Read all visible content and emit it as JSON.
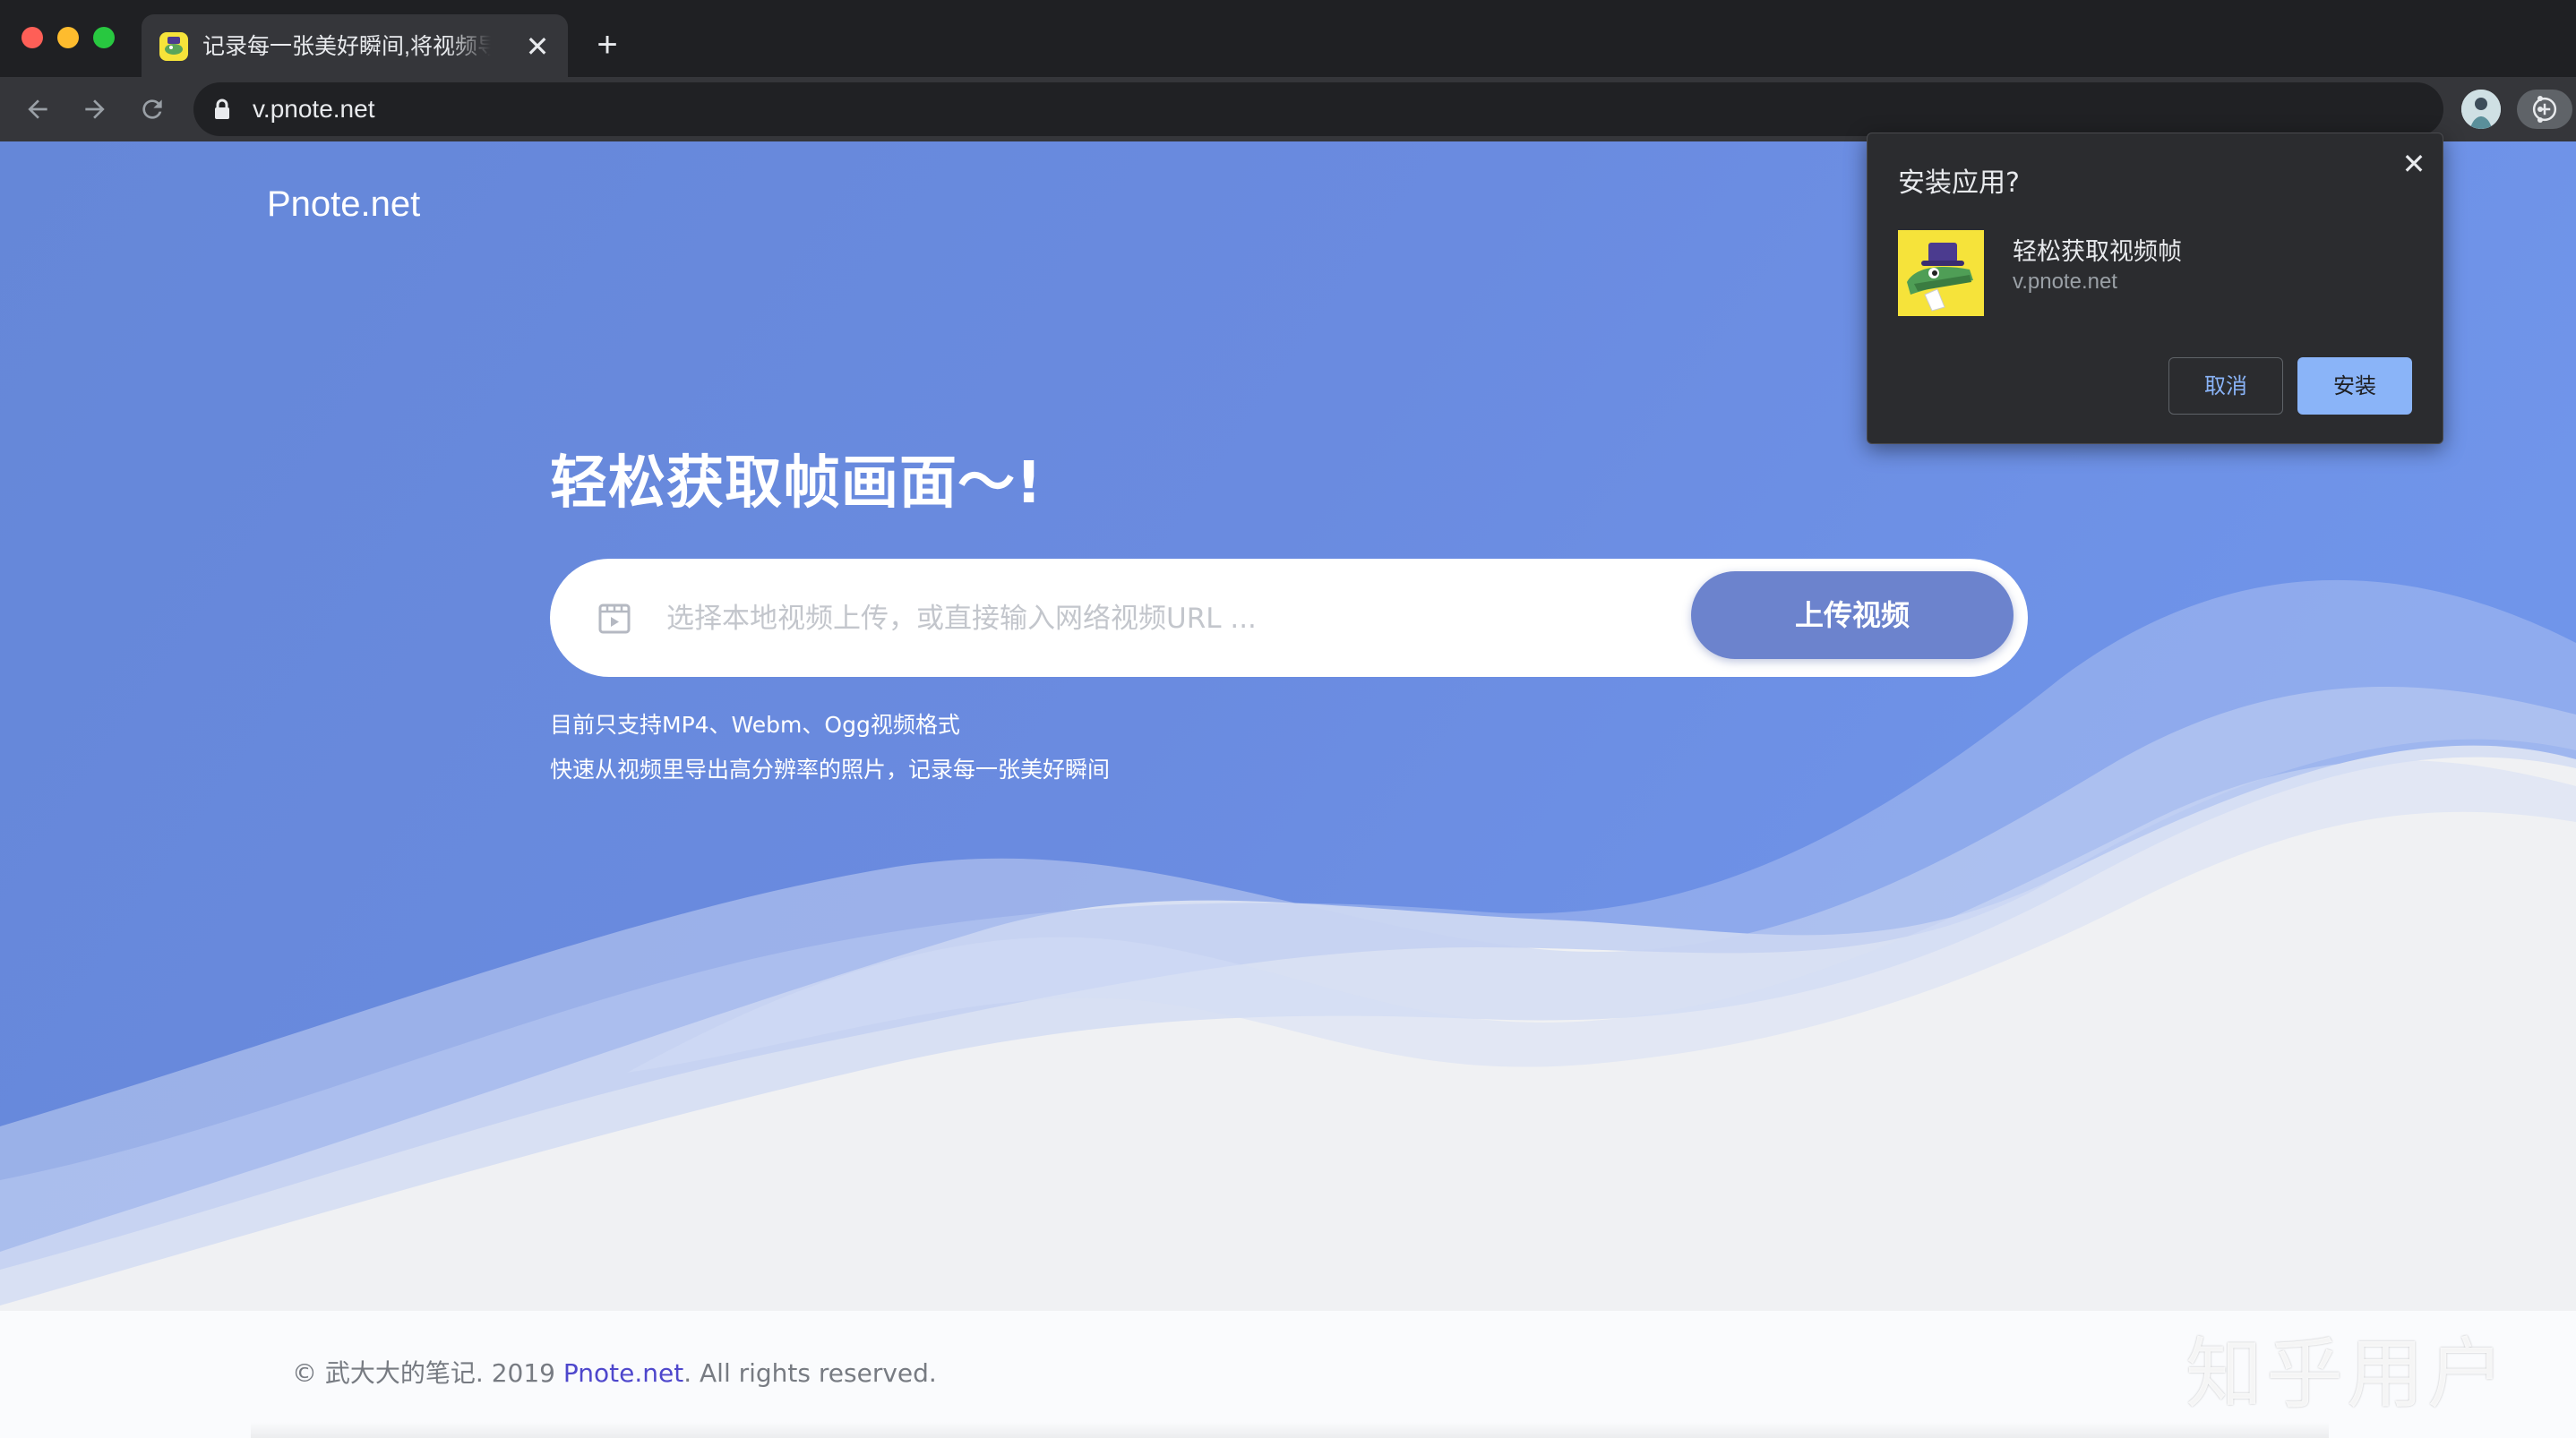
{
  "browser": {
    "tab_title": "记录每一张美好瞬间,将视频导出高分辨率的照片",
    "tab_close": "✕",
    "new_tab": "+",
    "url": "v.pnote.net"
  },
  "page": {
    "brand": "Pnote.net",
    "headline": "轻松获取帧画面～!",
    "search_placeholder": "选择本地视频上传，或直接输入网络视频URL ...",
    "upload_button": "上传视频",
    "note_formats": "目前只支持MP4、Webm、Ogg视频格式",
    "note_desc": "快速从视频里导出高分辨率的照片，记录每一张美好瞬间"
  },
  "footer": {
    "copyright_prefix": "© 武大大的笔记. 2019 ",
    "link_text": "Pnote.net",
    "copyright_suffix": ". All rights reserved.",
    "watermark": "知乎用户"
  },
  "install_dialog": {
    "title": "安装应用?",
    "close": "✕",
    "app_name": "轻松获取视频帧",
    "app_origin": "v.pnote.net",
    "cancel_label": "取消",
    "install_label": "安装"
  },
  "colors": {
    "hero_blue": "#6a89dd",
    "upload_button": "#6c83cd",
    "dialog_bg": "#2b2c2f",
    "install_accent": "#8ab4f8",
    "footer_link": "#4e47cc"
  },
  "icons": [
    "back-arrow-icon",
    "forward-arrow-icon",
    "reload-icon",
    "lock-icon",
    "install-app-icon",
    "bookmark-star-icon",
    "profile-avatar",
    "kebab-menu-icon",
    "video-file-icon",
    "close-icon"
  ]
}
